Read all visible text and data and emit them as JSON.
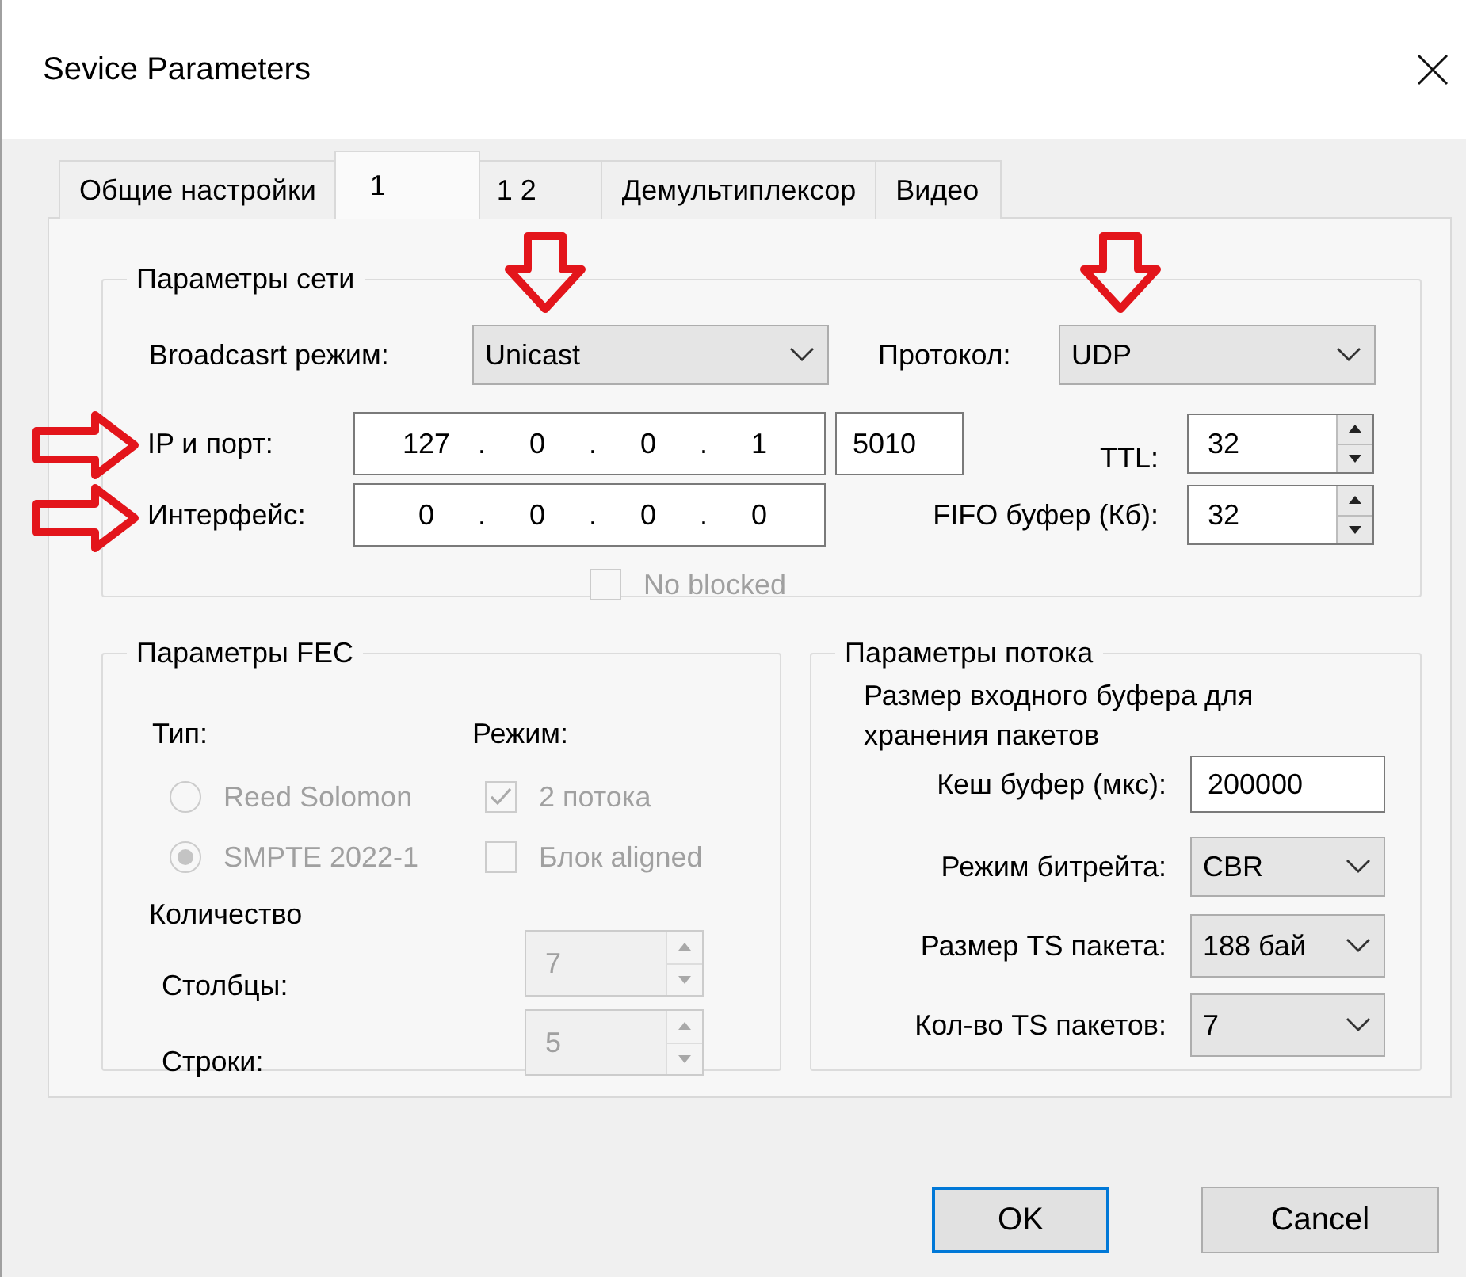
{
  "window": {
    "title": "Sevice Parameters"
  },
  "tabs": [
    {
      "label": "Общие настройки",
      "selected": false
    },
    {
      "label": "1",
      "selected": true
    },
    {
      "label": "1 2",
      "selected": false
    },
    {
      "label": "Демультиплексор",
      "selected": false
    },
    {
      "label": "Видео",
      "selected": false
    }
  ],
  "network": {
    "title": "Параметры сети",
    "broadcast_label": "Broadcasrt режим:",
    "broadcast_mode": "Unicast",
    "protocol_label": "Протокол:",
    "protocol": "UDP",
    "ip_label": "IP и порт:",
    "ip": [
      "127",
      ".",
      "0",
      ".",
      "0",
      ".",
      "1"
    ],
    "port": "5010",
    "ttl_label": "TTL:",
    "ttl": "32",
    "interface_label": "Интерфейс:",
    "interface": [
      "0",
      ".",
      "0",
      ".",
      "0",
      ".",
      "0"
    ],
    "fifo_label": "FIFO буфер (Кб):",
    "fifo": "32",
    "no_blocked": {
      "label": "No blocked",
      "checked": false,
      "disabled": true
    }
  },
  "fec": {
    "title": "Параметры FEC",
    "disabled": true,
    "type_label": "Тип:",
    "types": [
      {
        "label": "Reed Solomon",
        "selected": false
      },
      {
        "label": "SMPTE 2022-1",
        "selected": true
      }
    ],
    "mode_label": "Режим:",
    "modes": [
      {
        "label": "2 потока",
        "checked": true
      },
      {
        "label": "Блок aligned",
        "checked": false
      }
    ],
    "count_label": "Количество",
    "columns_label": "Столбцы:",
    "columns": "7",
    "rows_label": "Строки:",
    "rows": "5"
  },
  "stream": {
    "title": "Параметры потока",
    "note": "Размер входного буфера для хранения пакетов",
    "cache_label": "Кеш буфер (мкс):",
    "cache": "200000",
    "bitrate_label": "Режим битрейта:",
    "bitrate": "CBR",
    "ts_size_label": "Размер TS пакета:",
    "ts_size": "188 бай",
    "ts_count_label": "Кол-во TS пакетов:",
    "ts_count": "7"
  },
  "buttons": [
    {
      "label": "OK",
      "default": true
    },
    {
      "label": "Cancel",
      "default": false
    }
  ]
}
